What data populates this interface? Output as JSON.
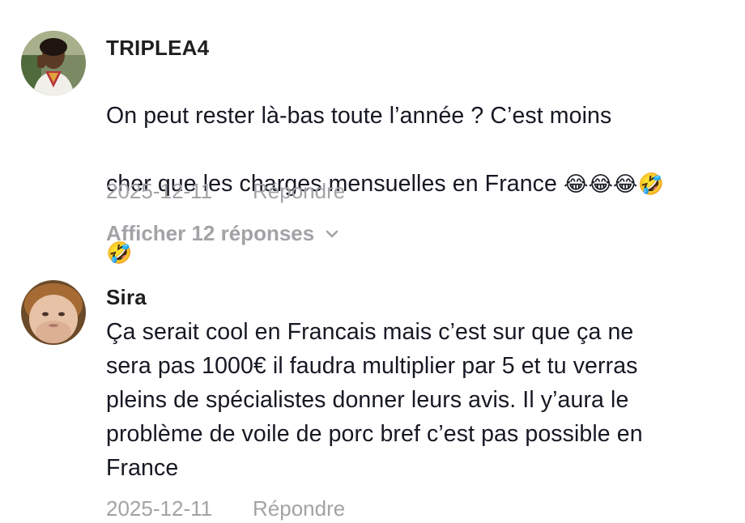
{
  "comments": [
    {
      "username": "TRIPLEA4",
      "text_line1": "On peut rester là-bas toute l’année ? C’est moins",
      "text_line2": "cher que les charges mensuelles en France ",
      "emoji_line2": "😂😂😂🤣",
      "emoji_line3": "🤣",
      "date": "2025-12-11",
      "reply_label": "Répondre",
      "view_replies_label": "Afficher 12 réponses",
      "avatar_icon": "person-avatar"
    },
    {
      "username": "Sira",
      "text": "Ça serait cool en Francais mais c’est sur que ça ne\nsera pas 1000€ il faudra multiplier par 5 et tu verras\npleins de spécialistes donner leurs avis. Il y’aura le\nproblème de voile de porc bref c’est pas possible en\nFrance",
      "date": "2025-12-11",
      "reply_label": "Répondre",
      "avatar_icon": "person-avatar"
    }
  ],
  "icons": {
    "chevron": "chevron-down-icon"
  },
  "colors": {
    "text": "#161823",
    "muted": "#a2a3a6"
  }
}
